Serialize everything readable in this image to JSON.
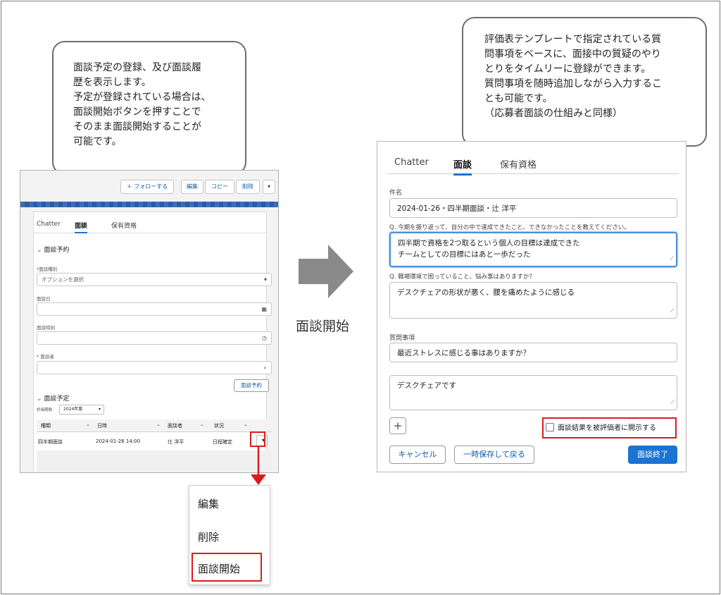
{
  "left_bubble": {
    "text": "面談予定の登録、及び面談履\n歴を表示します。\n予定が登録されている場合は、\n面談開始ボタンを押すことで\nそのまま面談開始することが\n可能です。"
  },
  "right_bubble": {
    "text": "評価表テンプレートで指定されている質\n問事項をベースに、面接中の質疑のやり\nとりをタイムリーに登録ができます。\n質問事項を随時追加しながら入力するこ\nとも可能です。\n（応募者面談の仕組みと同様）"
  },
  "left_panel": {
    "header_buttons": {
      "follow": "＋ フォローする",
      "edit": "編集",
      "copy": "コピー",
      "delete": "削除"
    },
    "tabs": [
      "Chatter",
      "面談",
      "保有資格"
    ],
    "section_reserve": "面談予約",
    "fields": {
      "type_label": "*面談種別",
      "type_placeholder": "オプションを選択",
      "date_label": "面談日",
      "time_label": "面談時刻",
      "interviewer_label": "* 面談者"
    },
    "reserve_button": "面談予約",
    "section_schedule": "面談予定",
    "filter_label": "評価期間",
    "filter_value": "2024年度",
    "table": {
      "headers": [
        "種類",
        "日時",
        "面談者",
        "状況"
      ],
      "rows": [
        {
          "type": "四半期面談",
          "datetime": "2024-01-26 14:00",
          "interviewer": "辻 洋平",
          "status": "日程確定"
        }
      ]
    }
  },
  "dropdown_menu": {
    "items": [
      "編集",
      "削除",
      "面談開始"
    ]
  },
  "center_label": "面談開始",
  "right_panel": {
    "tabs": [
      "Chatter",
      "面談",
      "保有資格"
    ],
    "subject_label": "件名",
    "subject_value": "2024-01-26・四半期面談・辻 洋平",
    "q1_label": "Q. 今期を振り返って、自分の中で達成できたこと、できなかったことを教えてください。",
    "q1_answer": "四半期で資格を2つ取るという個人の目標は達成できた\nチームとしての目標にはあと一歩だった",
    "q2_label": "Q. 職場環境で困っていること、悩み事はありますか？",
    "q2_answer": "デスクチェアの形状が悪く、腰を痛めたように感じる",
    "extra_label": "質問事項",
    "extra_question": "最近ストレスに感じる事はありますか？",
    "extra_answer": "デスクチェアです",
    "add_button": "+",
    "disclose_checkbox": "面談結果を被評価者に開示する",
    "cancel_button": "キャンセル",
    "save_back_button": "一時保存して戻る",
    "finish_button": "面談終了"
  },
  "colors": {
    "accent_red": "#d81e1e",
    "brand_blue": "#0b5cab",
    "primary_button": "#1b73d3",
    "arrow_gray": "#8a8a8a"
  }
}
